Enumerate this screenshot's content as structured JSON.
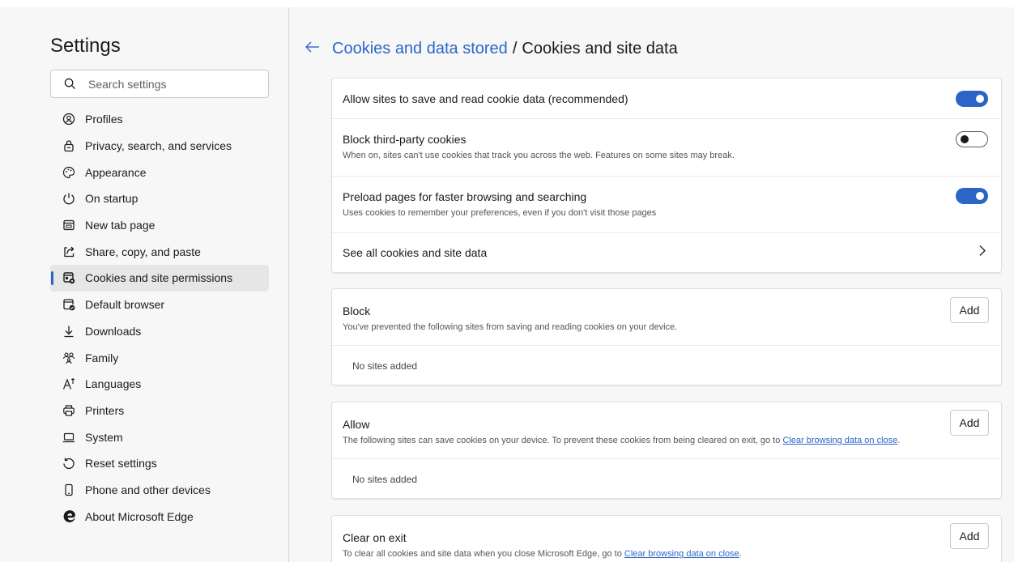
{
  "sidebar": {
    "title": "Settings",
    "search_placeholder": "Search settings",
    "items": [
      {
        "label": "Profiles",
        "icon": "profile-icon"
      },
      {
        "label": "Privacy, search, and services",
        "icon": "lock-icon"
      },
      {
        "label": "Appearance",
        "icon": "palette-icon"
      },
      {
        "label": "On startup",
        "icon": "power-icon"
      },
      {
        "label": "New tab page",
        "icon": "new-tab-icon"
      },
      {
        "label": "Share, copy, and paste",
        "icon": "share-icon"
      },
      {
        "label": "Cookies and site permissions",
        "icon": "cookies-icon",
        "active": true
      },
      {
        "label": "Default browser",
        "icon": "default-browser-icon"
      },
      {
        "label": "Downloads",
        "icon": "download-icon"
      },
      {
        "label": "Family",
        "icon": "family-icon"
      },
      {
        "label": "Languages",
        "icon": "languages-icon"
      },
      {
        "label": "Printers",
        "icon": "printer-icon"
      },
      {
        "label": "System",
        "icon": "laptop-icon"
      },
      {
        "label": "Reset settings",
        "icon": "reset-icon"
      },
      {
        "label": "Phone and other devices",
        "icon": "phone-icon"
      },
      {
        "label": "About Microsoft Edge",
        "icon": "edge-logo-icon"
      }
    ]
  },
  "header": {
    "parent": "Cookies and data stored",
    "separator": "/",
    "current": "Cookies and site data"
  },
  "settings_card": {
    "allow_title": "Allow sites to save and read cookie data (recommended)",
    "allow_on": true,
    "block_third_title": "Block third-party cookies",
    "block_third_desc": "When on, sites can't use cookies that track you across the web. Features on some sites may break.",
    "block_third_on": false,
    "preload_title": "Preload pages for faster browsing and searching",
    "preload_desc": "Uses cookies to remember your preferences, even if you don't visit those pages",
    "preload_on": true,
    "see_all_title": "See all cookies and site data"
  },
  "block_card": {
    "title": "Block",
    "desc": "You've prevented the following sites from saving and reading cookies on your device.",
    "add_label": "Add",
    "empty": "No sites added"
  },
  "allow_card": {
    "title": "Allow",
    "desc": "The following sites can save cookies on your device. To prevent these cookies from being cleared on exit, go to",
    "link": "Clear browsing data on close",
    "period": ".",
    "add_label": "Add",
    "empty": "No sites added"
  },
  "clear_card": {
    "title": "Clear on exit",
    "desc": "To clear all cookies and site data when you close Microsoft Edge, go to",
    "link": "Clear browsing data on close",
    "period": ".",
    "add_label": "Add"
  },
  "colors": {
    "accent": "#2b66c7",
    "background": "#f7f7f7",
    "card": "#ffffff"
  }
}
